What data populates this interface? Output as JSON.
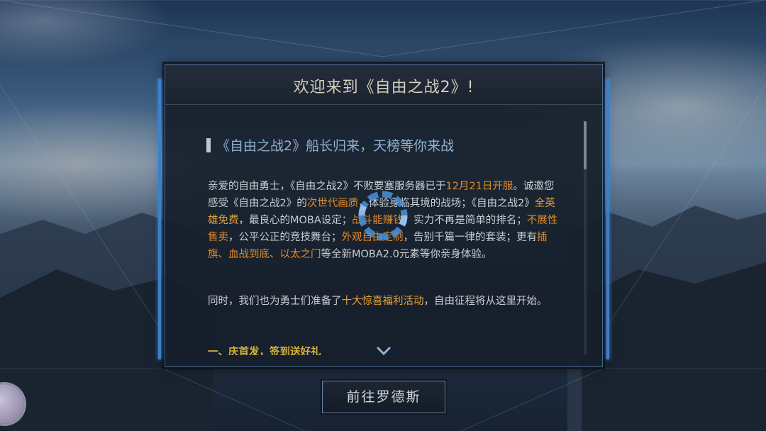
{
  "dialog": {
    "title": "欢迎来到《自由之战2》!",
    "heading": "《自由之战2》船长归来，天榜等你来战",
    "para1": {
      "a": "亲爱的自由勇士，《自由之战2》不败要塞服务器已于",
      "b": "12月21日开服",
      "c": "。诚邀您感受《自由之战2》的",
      "d": "次世代画质",
      "e": "，体验身临其境的战场；《自由之战2》",
      "f": "全英雄免费",
      "g": "，最良心的MOBA设定；",
      "h": "战斗能赚钱",
      "i": "，实力不再是简单的排名；",
      "j": "不展性售卖",
      "k": "，公平公正的竞技舞台；",
      "l": "外观自由定制",
      "m": "，告别千篇一律的套装；更有",
      "n": "插旗、血战到底、以太之门",
      "o": "等全新MOBA2.0元素等你亲身体验。"
    },
    "para2": {
      "a": "同时，我们也为勇士们准备了",
      "b": "十大惊喜福利活动",
      "c": "，自由征程将从这里开始。"
    },
    "para3": "一、庆首发，签到送好礼",
    "goto_button": "前往罗德斯"
  },
  "icons": {
    "scroll_down": "chevron-down-icon",
    "loading": "loading-spinner-icon",
    "logo": "game-logo-icon"
  },
  "colors": {
    "highlight": "#e08a2a",
    "accent_blue": "#3e7fc8",
    "section_gold": "#d9b23c"
  }
}
